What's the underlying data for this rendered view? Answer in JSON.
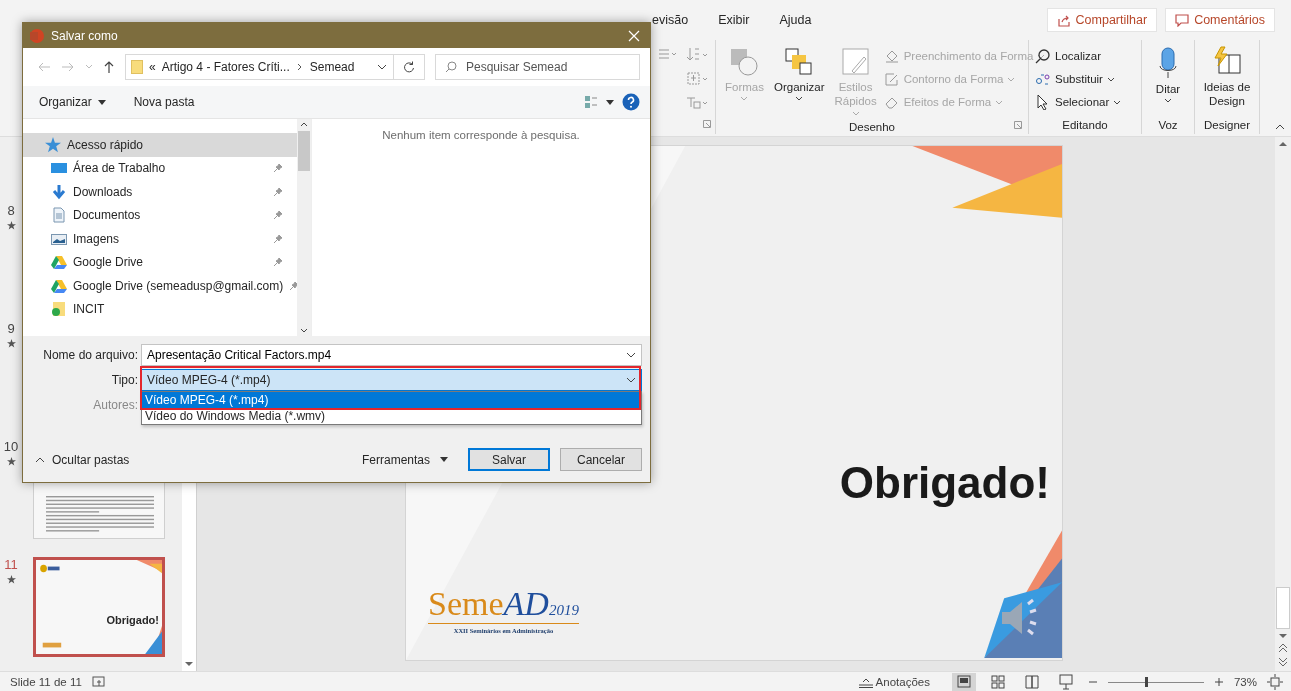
{
  "menu_tabs": [
    {
      "label": "evisão",
      "selected": false
    },
    {
      "label": "Exibir",
      "selected": false
    },
    {
      "label": "Ajuda",
      "selected": false
    }
  ],
  "share_button": "Compartilhar",
  "comments_button": "Comentários",
  "ribbon_groups": [
    {
      "label": "Desenho",
      "items": [
        {
          "label": "Formas",
          "kind": "large",
          "disabled": true
        },
        {
          "label": "Organizar",
          "kind": "large",
          "disabled": false
        },
        {
          "label": "Estilos Rápidos",
          "kind": "large",
          "disabled": true
        },
        {
          "label": "Preenchimento da Forma",
          "kind": "small",
          "disabled": true
        },
        {
          "label": "Contorno da Forma",
          "kind": "small",
          "disabled": true
        },
        {
          "label": "Efeitos de Forma",
          "kind": "small",
          "disabled": true
        }
      ]
    },
    {
      "label": "Editando",
      "items": [
        {
          "label": "Localizar",
          "kind": "small",
          "disabled": false
        },
        {
          "label": "Substituir",
          "kind": "small",
          "disabled": false
        },
        {
          "label": "Selecionar",
          "kind": "small",
          "disabled": false
        }
      ]
    },
    {
      "label": "Voz",
      "items": [
        {
          "label": "Ditar",
          "kind": "large",
          "disabled": false
        }
      ]
    },
    {
      "label": "Designer",
      "items": [
        {
          "label": "Ideias de Design",
          "kind": "large",
          "disabled": false
        }
      ]
    }
  ],
  "slides": [
    {
      "number": "8",
      "selected": false
    },
    {
      "number": "9",
      "selected": false
    },
    {
      "number": "10",
      "selected": false
    },
    {
      "number": "11",
      "selected": true,
      "title": "Obrigado!"
    }
  ],
  "slide": {
    "title": "Obrigado!",
    "logo": {
      "main": "Seme",
      "accent": "AD",
      "year": "2019"
    },
    "logo_caption": "XXII Seminários em Administração"
  },
  "status_bar": {
    "slide_counter": "Slide 11 de 11",
    "notes": "Anotações",
    "zoom": "73%",
    "zoom_slider": {
      "level": 0.4
    }
  },
  "dialog": {
    "title": "Salvar como",
    "overflow_mark": "«",
    "breadcrumb": [
      "Artigo 4 - Fatores Críti...",
      "Semead"
    ],
    "search_placeholder": "Pesquisar Semead",
    "organize": "Organizar",
    "new_folder": "Nova pasta",
    "nav_items": [
      {
        "label": "Acesso rápido",
        "kind": "star",
        "selected": true,
        "pinned": false
      },
      {
        "label": "Área de Trabalho",
        "kind": "desktop",
        "selected": false,
        "pinned": true
      },
      {
        "label": "Downloads",
        "kind": "download",
        "selected": false,
        "pinned": true
      },
      {
        "label": "Documentos",
        "kind": "document",
        "selected": false,
        "pinned": true
      },
      {
        "label": "Imagens",
        "kind": "image",
        "selected": false,
        "pinned": true
      },
      {
        "label": "Google Drive",
        "kind": "drive",
        "selected": false,
        "pinned": true
      },
      {
        "label": "Google Drive (semeadusp@gmail.com)",
        "kind": "drive",
        "selected": false,
        "pinned": true
      },
      {
        "label": "INCIT",
        "kind": "folder",
        "selected": false,
        "pinned": false
      }
    ],
    "empty_message": "Nenhum item corresponde à pesquisa.",
    "file_name_label": "Nome do arquivo:",
    "file_name": "Apresentação Critical Factors.mp4",
    "type_label": "Tipo:",
    "type_value": "Vídeo MPEG-4 (*.mp4)",
    "type_options": [
      {
        "label": "Vídeo MPEG-4 (*.mp4)",
        "selected": true
      },
      {
        "label": "Vídeo do Windows Media (*.wmv)",
        "selected": false
      }
    ],
    "authors_label": "Autores:",
    "hide_folders": "Ocultar pastas",
    "tools": "Ferramentas",
    "save": "Salvar",
    "cancel": "Cancelar"
  }
}
